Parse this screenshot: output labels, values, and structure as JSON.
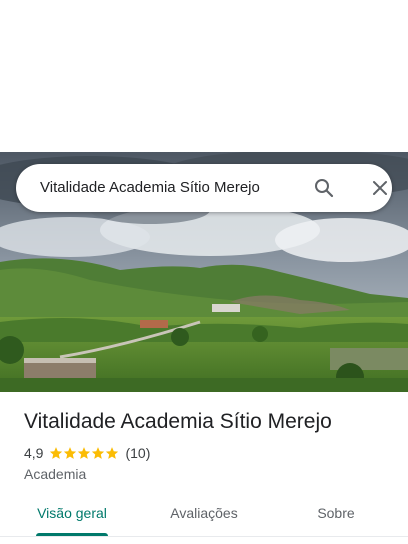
{
  "search": {
    "query": "Vitalidade Academia Sítio Merejo",
    "search_icon": "search-icon",
    "close_icon": "close-icon"
  },
  "place": {
    "name": "Vitalidade Academia Sítio Merejo",
    "rating": "4,9",
    "rating_value": 4.9,
    "stars_max": 5,
    "review_count": "(10)",
    "category": "Academia"
  },
  "tabs": [
    {
      "label": "Visão geral",
      "active": true
    },
    {
      "label": "Avaliações",
      "active": false
    },
    {
      "label": "Sobre",
      "active": false
    }
  ],
  "colors": {
    "accent": "#00796b",
    "star": "#fbbc04"
  }
}
